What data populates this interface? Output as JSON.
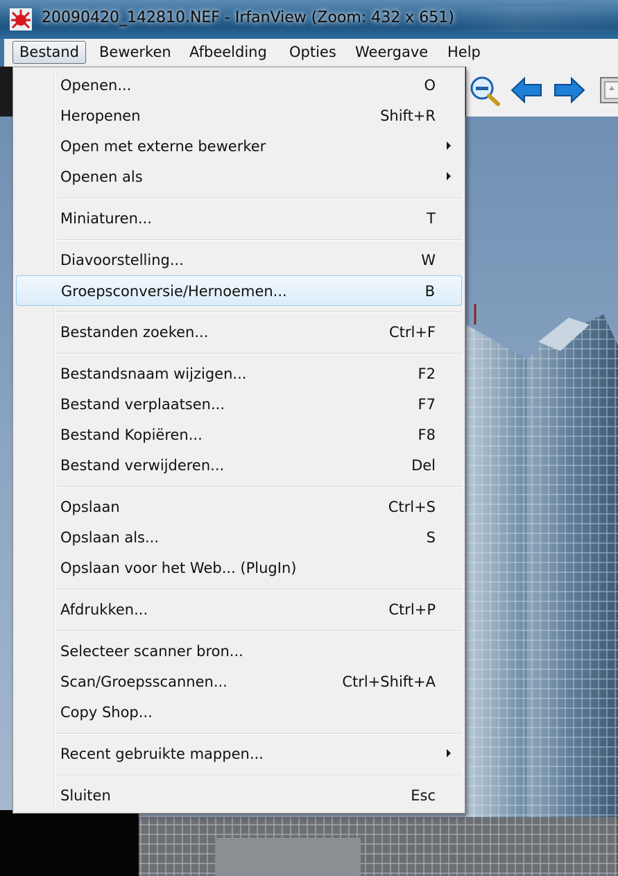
{
  "window": {
    "title": "20090420_142810.NEF - IrfanView (Zoom: 432 x 651)",
    "app_icon": "irfanview-red-cat-icon"
  },
  "menubar": {
    "items": [
      {
        "label": "Bestand",
        "active": true
      },
      {
        "label": "Bewerken"
      },
      {
        "label": "Afbeelding"
      },
      {
        "label": "Opties"
      },
      {
        "label": "Weergave"
      },
      {
        "label": "Help"
      }
    ]
  },
  "toolbar": {
    "icons": [
      "zoom-out-icon",
      "previous-arrow-icon",
      "next-arrow-icon",
      "thumbnails-icon"
    ]
  },
  "file_menu": {
    "items": [
      {
        "label": "Openen...",
        "shortcut": "O"
      },
      {
        "label": "Heropenen",
        "shortcut": "Shift+R"
      },
      {
        "label": "Open met externe bewerker",
        "shortcut": "",
        "submenu": true
      },
      {
        "label": "Openen als",
        "shortcut": "",
        "submenu": true
      },
      {
        "label": "Miniaturen...",
        "shortcut": "T"
      },
      {
        "label": "Diavoorstelling...",
        "shortcut": "W"
      },
      {
        "label": "Groepsconversie/Hernoemen...",
        "shortcut": "B",
        "highlighted": true
      },
      {
        "label": "Bestanden zoeken...",
        "shortcut": "Ctrl+F"
      },
      {
        "label": "Bestandsnaam wijzigen...",
        "shortcut": "F2"
      },
      {
        "label": "Bestand verplaatsen...",
        "shortcut": "F7"
      },
      {
        "label": "Bestand Kopiëren...",
        "shortcut": "F8"
      },
      {
        "label": "Bestand verwijderen...",
        "shortcut": "Del"
      },
      {
        "label": "Opslaan",
        "shortcut": "Ctrl+S"
      },
      {
        "label": "Opslaan als...",
        "shortcut": "S"
      },
      {
        "label": "Opslaan voor het Web... (PlugIn)",
        "shortcut": ""
      },
      {
        "label": "Afdrukken...",
        "shortcut": "Ctrl+P"
      },
      {
        "label": "Selecteer scanner bron...",
        "shortcut": ""
      },
      {
        "label": "Scan/Groepsscannen...",
        "shortcut": "Ctrl+Shift+A"
      },
      {
        "label": "Copy Shop...",
        "shortcut": ""
      },
      {
        "label": "Recent gebruikte mappen...",
        "shortcut": "",
        "submenu": true
      },
      {
        "label": "Sluiten",
        "shortcut": "Esc"
      }
    ]
  },
  "colors": {
    "menu_bg": "#f0f0f0",
    "highlight_border": "#9ecbe9",
    "titlebar": "#2f6593",
    "toolbar_arrow": "#1e7fd6"
  }
}
